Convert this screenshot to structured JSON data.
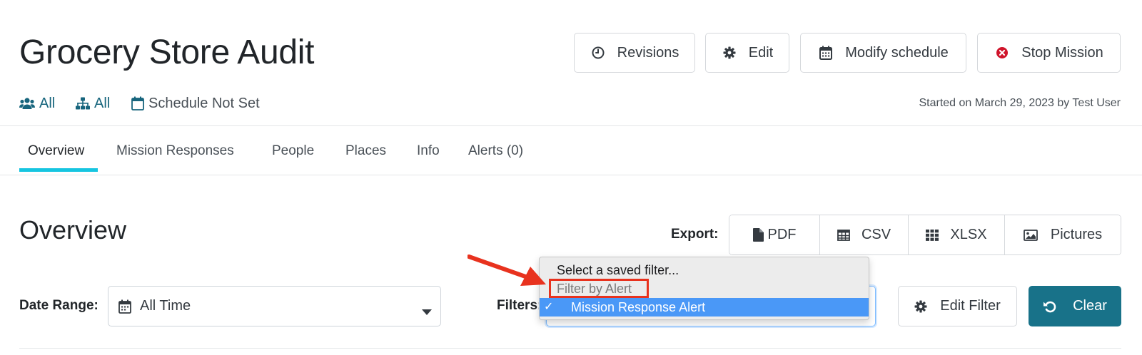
{
  "header": {
    "title": "Grocery Store Audit",
    "buttons": {
      "revisions": "Revisions",
      "edit": "Edit",
      "modify_schedule": "Modify schedule",
      "stop_mission": "Stop Mission"
    }
  },
  "meta": {
    "teams": "All",
    "hierarchy": "All",
    "schedule": "Schedule Not Set",
    "started": "Started on March 29, 2023 by Test User"
  },
  "tabs": [
    {
      "label": "Overview",
      "active": true
    },
    {
      "label": "Mission Responses",
      "active": false
    },
    {
      "label": "People",
      "active": false
    },
    {
      "label": "Places",
      "active": false
    },
    {
      "label": "Info",
      "active": false
    },
    {
      "label": "Alerts (0)",
      "active": false
    }
  ],
  "overview": {
    "title": "Overview",
    "export_label": "Export:",
    "export_buttons": {
      "pdf": "PDF",
      "csv": "CSV",
      "xlsx": "XLSX",
      "pictures": "Pictures"
    },
    "date_range_label": "Date Range:",
    "date_range_value": "All Time",
    "filters_label": "Filters:",
    "edit_filter": "Edit Filter",
    "clear": "Clear"
  },
  "filter_dropdown": {
    "options": [
      {
        "label": "Select a saved filter...",
        "state": "normal"
      },
      {
        "label": "Filter by Alert",
        "state": "disabled"
      },
      {
        "label": "Mission Response Alert",
        "state": "selected"
      }
    ],
    "check": "✓"
  },
  "colors": {
    "link": "#17657d",
    "tab_active_underline": "#16c5e0",
    "clear_button": "#187289",
    "selected_option": "#4a98f7",
    "stop_icon": "#d0142b",
    "annotation": "#e8321e"
  },
  "icons": {
    "revisions": "clock-icon",
    "edit": "gear-icon",
    "modify_schedule": "calendar-icon",
    "stop_mission": "times-circle-icon",
    "teams": "users-icon",
    "hierarchy": "sitemap-icon",
    "schedule": "calendar-icon",
    "pdf": "file-icon",
    "csv": "table-icon",
    "xlsx": "grid-icon",
    "pictures": "image-icon",
    "edit_filter": "gear-icon",
    "clear": "undo-icon"
  }
}
